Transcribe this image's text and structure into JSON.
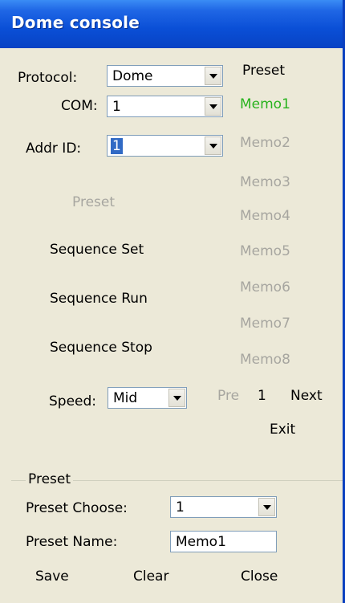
{
  "window": {
    "title": "Dome console"
  },
  "protocol": {
    "label": "Protocol:",
    "value": "Dome"
  },
  "com": {
    "label": "COM:",
    "value": "1"
  },
  "addr": {
    "label": "Addr ID:",
    "value": "1"
  },
  "preset_header": "Preset",
  "memos": [
    "Memo1",
    "Memo2",
    "Memo3",
    "Memo4",
    "Memo5",
    "Memo6",
    "Memo7",
    "Memo8"
  ],
  "preset_button": "Preset",
  "sequence": {
    "set": "Sequence Set",
    "run": "Sequence Run",
    "stop": "Sequence Stop"
  },
  "speed": {
    "label": "Speed:",
    "value": "Mid"
  },
  "pager": {
    "pre": "Pre",
    "page": "1",
    "next": "Next"
  },
  "exit": "Exit",
  "preset_group": {
    "title": "Preset",
    "choose_label": "Preset Choose:",
    "choose_value": "1",
    "name_label": "Preset Name:",
    "name_value": "Memo1",
    "save": "Save",
    "clear": "Clear",
    "close": "Close"
  },
  "colors": {
    "title_bar": "#0a4fd6",
    "window_bg": "#ece9d8",
    "active_memo": "#29b31f",
    "disabled_text": "#a7a6a0"
  }
}
